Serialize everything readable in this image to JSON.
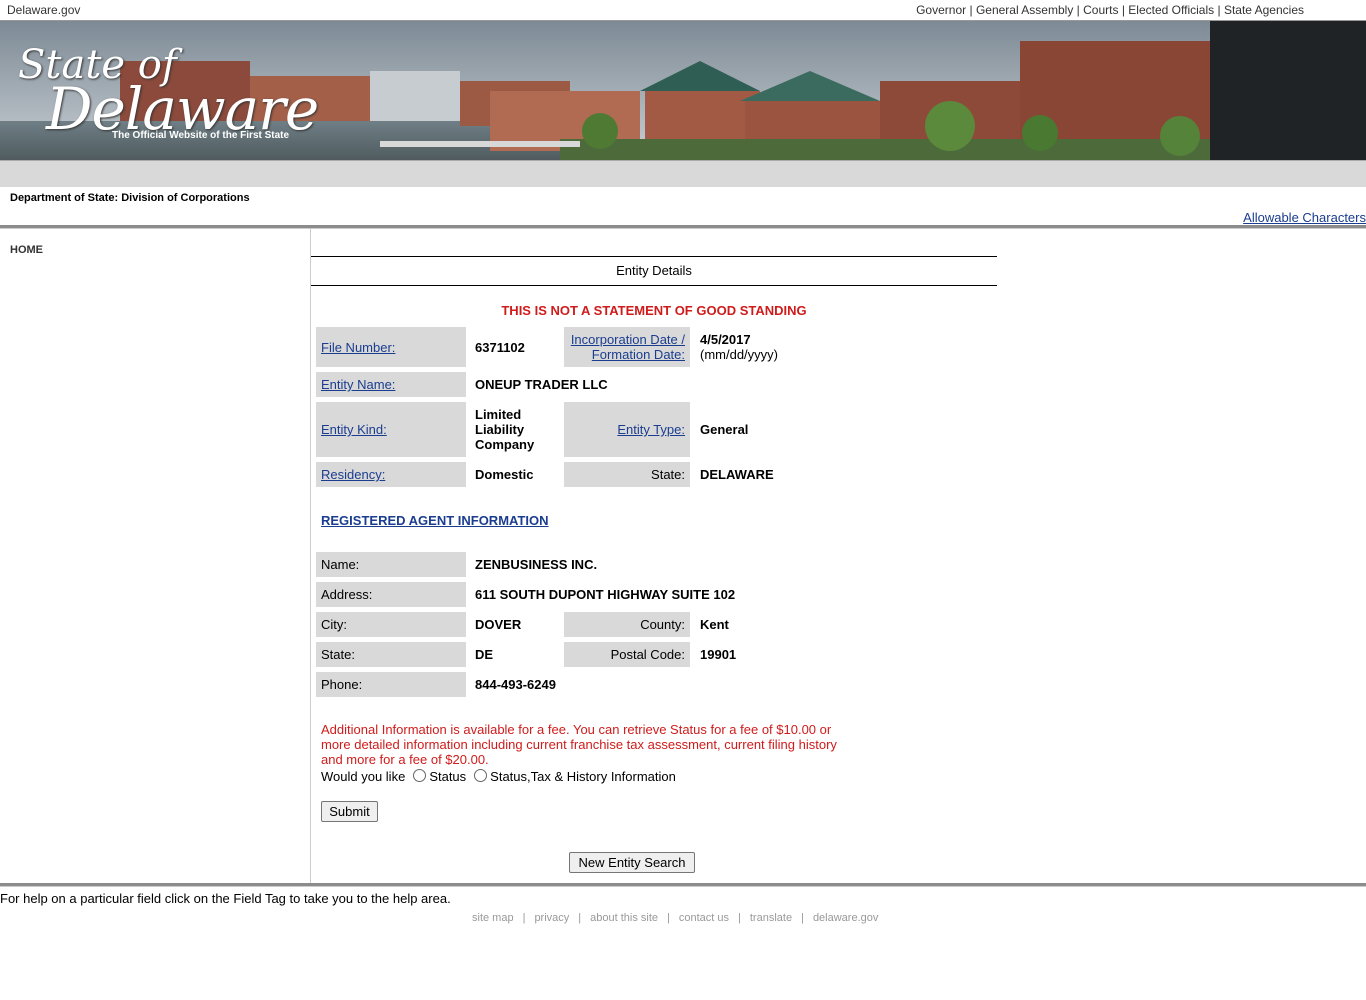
{
  "topbar": {
    "site": "Delaware.gov",
    "links": [
      "Governor",
      "General Assembly",
      "Courts",
      "Elected Officials",
      "State Agencies"
    ],
    "separator": "|"
  },
  "banner": {
    "logo_line1": "State of",
    "logo_line2": "Delaware",
    "tagline": "The Official Website of the First State"
  },
  "department": {
    "title": "Department of State: Division of Corporations",
    "allowable_link": "Allowable Characters"
  },
  "sidebar": {
    "home": "HOME"
  },
  "entity": {
    "header": "Entity Details",
    "warning": "THIS IS NOT A STATEMENT OF GOOD STANDING",
    "file_number_label": "File Number:",
    "file_number": "6371102",
    "inc_date_label_1": "Incorporation Date /",
    "inc_date_label_2": "Formation Date:",
    "inc_date": "4/5/2017",
    "inc_date_format": "(mm/dd/yyyy)",
    "entity_name_label": "Entity Name:",
    "entity_name": "ONEUP TRADER LLC",
    "entity_kind_label": "Entity Kind:",
    "entity_kind_1": "Limited",
    "entity_kind_2": "Liability",
    "entity_kind_3": "Company",
    "entity_type_label": "Entity Type:",
    "entity_type": "General",
    "residency_label": "Residency:",
    "residency": "Domestic",
    "state_label": "State:",
    "state": "DELAWARE"
  },
  "agent": {
    "section_title": "REGISTERED AGENT INFORMATION",
    "name_label": "Name:",
    "name": "ZENBUSINESS INC.",
    "address_label": "Address:",
    "address": "611 SOUTH DUPONT HIGHWAY SUITE 102",
    "city_label": "City:",
    "city": "DOVER",
    "county_label": "County:",
    "county": "Kent",
    "state_label": "State:",
    "state": "DE",
    "postal_label": "Postal Code:",
    "postal": "19901",
    "phone_label": "Phone:",
    "phone": "844-493-6249"
  },
  "fee": {
    "text": "Additional Information is available for a fee. You can retrieve Status for a fee of $10.00 or more detailed information including current franchise tax assessment, current filing history and more for a fee of $20.00.",
    "question": "Would you like",
    "option_status": "Status",
    "option_full": "Status,Tax & History Information",
    "submit": "Submit"
  },
  "new_search": "New Entity Search",
  "help_text": "For help on a particular field click on the Field Tag to take you to the help area.",
  "footer": {
    "links": [
      "site map",
      "privacy",
      "about this site",
      "contact us",
      "translate",
      "delaware.gov"
    ],
    "separator": "|"
  }
}
